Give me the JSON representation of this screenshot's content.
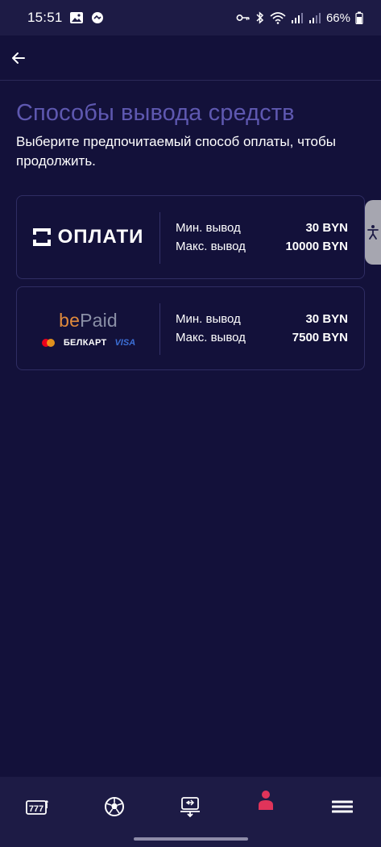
{
  "status_bar": {
    "time": "15:51",
    "battery": "66%"
  },
  "page": {
    "title": "Способы вывода средств",
    "subtitle": "Выберите предпочитаемый способ оплаты, чтобы продолжить."
  },
  "methods": [
    {
      "logo_text": "ОПЛАТИ",
      "min_label": "Мин. вывод",
      "min_value": "30 BYN",
      "max_label": "Макс. вывод",
      "max_value": "10000 BYN"
    },
    {
      "logo_be": "be",
      "logo_paid": "Paid",
      "card_brands": [
        "БЕЛКАРТ",
        "VISA"
      ],
      "min_label": "Мин. вывод",
      "min_value": "30 BYN",
      "max_label": "Макс. вывод",
      "max_value": "7500 BYN"
    }
  ],
  "bottom_nav": [
    {
      "icon": "slot-machine-icon"
    },
    {
      "icon": "soccer-ball-icon"
    },
    {
      "icon": "transfer-icon"
    },
    {
      "icon": "profile-icon",
      "active": true
    },
    {
      "icon": "menu-icon"
    }
  ],
  "colors": {
    "background": "#13113a",
    "bar": "#1d1b45",
    "title": "#5e58b0",
    "accent_active": "#e0345a"
  }
}
